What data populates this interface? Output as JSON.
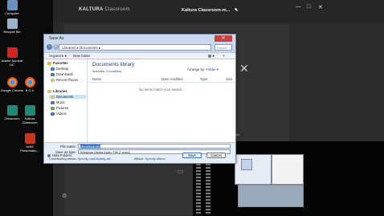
{
  "desktop": {
    "icons": [
      {
        "label": "Computer",
        "color": "#6b8fbf"
      },
      {
        "label": "Recycle Bin",
        "color": "#9bb3cf"
      },
      {
        "label": "Adobe Acrobat DC",
        "color": "#d42323"
      },
      {
        "label": "Google Chrome",
        "color": "#e9b824"
      },
      {
        "label": "B O X",
        "color": "#e9b824"
      },
      {
        "label": "Classroom",
        "color": "#1d8a73"
      },
      {
        "label": "Kaltura Classroom",
        "color": "#1d8a73"
      },
      {
        "label": "Unit2 Presentatio...",
        "color": "#c8361e"
      }
    ]
  },
  "kaltura": {
    "logo_brand": "KALTURA",
    "logo_sub": "Classroom",
    "title": "Kaltura Classroom-m...",
    "edit_icon": "pencil-icon",
    "window_controls": [
      "—",
      "□",
      "✕"
    ],
    "close_x": "✕",
    "video_label": "ideo"
  },
  "dialog": {
    "title": "Save As",
    "address": "Libraries  ▸  Documents  ▸",
    "search_placeholder": "Search Documents",
    "toolbar": {
      "organize": "Organize ▾",
      "new_folder": "New folder"
    },
    "nav": {
      "favorites_header": "Favorites",
      "favorites": [
        "Desktop",
        "Downloads",
        "Recent Places"
      ],
      "libraries_header": "Libraries",
      "libraries": [
        "Documents",
        "Music",
        "Pictures",
        "Videos"
      ],
      "selected": "Documents"
    },
    "content": {
      "library_title": "Documents library",
      "includes_prefix": "Includes:",
      "includes_link": "2 locations",
      "arrange_by_label": "Arrange by:",
      "arrange_by_value": "Folder ▾",
      "columns": [
        "Name",
        "Date modified",
        "Type",
        "Size"
      ],
      "empty_message": "No items match your search."
    },
    "filename_label": "File name:",
    "filename_value": "checkforaudio",
    "savetype_label": "Save as type:",
    "savetype_value": "Windows Media Audio File (*.wma)",
    "contributing_label": "Contributing artists:",
    "contributing_value": "Specify contributing art...",
    "album_label": "Album:",
    "album_value": "Specify album",
    "hide_folders": "Hide Folders",
    "save_button": "Save",
    "cancel_button": "Cancel"
  }
}
